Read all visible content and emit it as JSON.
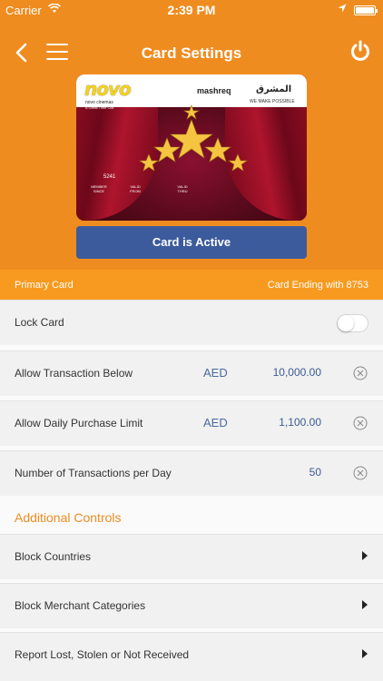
{
  "status_bar": {
    "carrier": "Carrier",
    "time": "2:39 PM",
    "wifi_icon": "wifi-icon",
    "location_icon": "location-arrow-icon",
    "battery_level": 1.0
  },
  "header": {
    "title": "Card Settings",
    "back_icon": "chevron-left-icon",
    "menu_icon": "hamburger-menu-icon",
    "power_icon": "power-icon"
  },
  "card": {
    "brand": "novo",
    "brand_sub": "novo cinemas",
    "brand_tagline": "A Great Time Out.",
    "bank": "mashreq",
    "bank_arabic": "المشرق",
    "bank_tagline": "WE MAKE POSSIBLE",
    "number_fragment": "5241",
    "member_since_label": "MEMBER SINCE",
    "valid_from_label": "VALID FROM",
    "valid_thru_label": "VALID THRU"
  },
  "status_button": {
    "label": "Card is Active"
  },
  "card_info": {
    "primary": "Primary Card",
    "ending": "Card Ending with 8753"
  },
  "settings": {
    "lock": {
      "label": "Lock Card",
      "enabled": false
    },
    "transaction_below": {
      "label": "Allow Transaction Below",
      "currency": "AED",
      "amount": "10,000.00"
    },
    "daily_limit": {
      "label": "Allow Daily Purchase Limit",
      "currency": "AED",
      "amount": "1,100.00"
    },
    "per_day": {
      "label": "Number of Transactions per Day",
      "amount": "50"
    }
  },
  "additional": {
    "title": "Additional Controls",
    "items": [
      {
        "label": "Block Countries"
      },
      {
        "label": "Block Merchant Categories"
      },
      {
        "label": "Report Lost, Stolen or Not Received"
      }
    ]
  },
  "colors": {
    "header_orange": "#ef8c1f",
    "info_orange": "#f89a1f",
    "button_blue": "#3c5b9c",
    "value_blue": "#3a5a94"
  }
}
